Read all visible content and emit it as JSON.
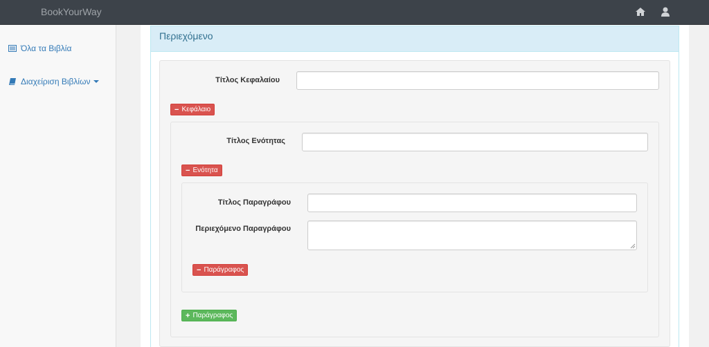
{
  "navbar": {
    "brand": "BookYourWay",
    "icons": [
      "home-icon",
      "user-icon"
    ]
  },
  "sidebar": {
    "items": [
      {
        "label": "Όλα τα Βιβλία",
        "icon": "list-icon"
      },
      {
        "label": "Διαχείριση Βιβλίων",
        "icon": "book-icon",
        "dropdown": true
      }
    ]
  },
  "panel": {
    "title": "Περιεχόμενο"
  },
  "chapter": {
    "title_label": "Τίτλος Κεφαλαίου",
    "title_value": "",
    "remove_label": "Κεφάλαιο"
  },
  "section": {
    "title_label": "Τίτλος Ενότητας",
    "title_value": "",
    "remove_label": "Ενότητα"
  },
  "paragraph": {
    "title_label": "Τίτλος Παραγράφου",
    "title_value": "",
    "content_label": "Περιεχόμενο Παραγράφου",
    "content_value": "",
    "remove_label": "Παράγραφος",
    "add_label": "Παράγραφος"
  },
  "colors": {
    "navbar": "#3d434a",
    "link": "#337ab7",
    "panel_heading": "#d9edf7",
    "danger": "#d9534f",
    "success": "#5cb85c"
  }
}
